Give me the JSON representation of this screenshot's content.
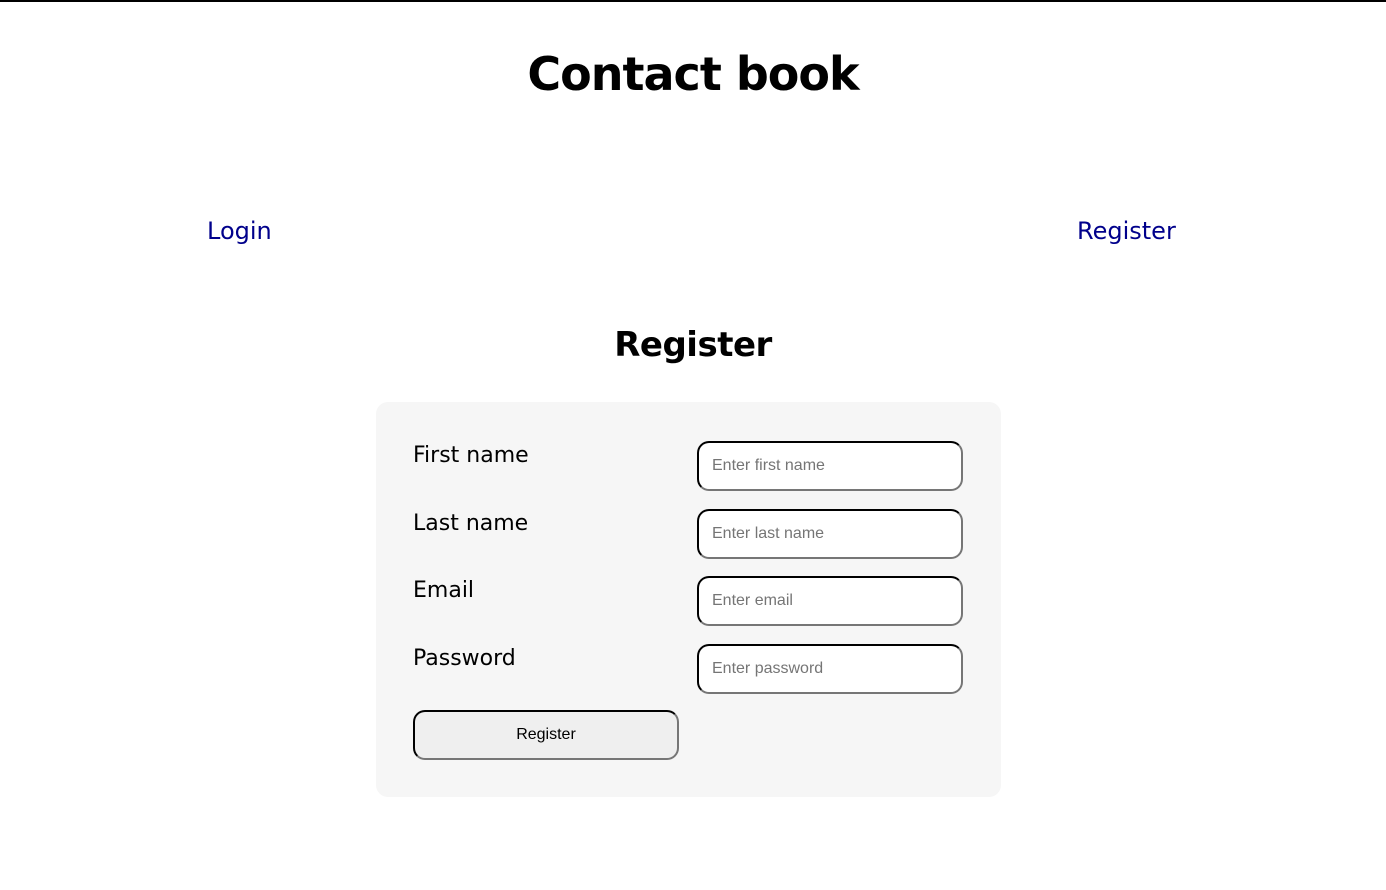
{
  "header": {
    "title": "Contact book"
  },
  "nav": {
    "login_label": "Login",
    "register_label": "Register"
  },
  "form": {
    "heading": "Register",
    "fields": [
      {
        "label": "First name",
        "placeholder": "Enter first name",
        "value": ""
      },
      {
        "label": "Last name",
        "placeholder": "Enter last name",
        "value": ""
      },
      {
        "label": "Email",
        "placeholder": "Enter email",
        "value": ""
      },
      {
        "label": "Password",
        "placeholder": "Enter password",
        "value": ""
      }
    ],
    "submit_label": "Register"
  },
  "colors": {
    "link": "#00008b",
    "card_background": "#f6f6f6",
    "button_background": "#efefef",
    "placeholder": "#757575"
  }
}
